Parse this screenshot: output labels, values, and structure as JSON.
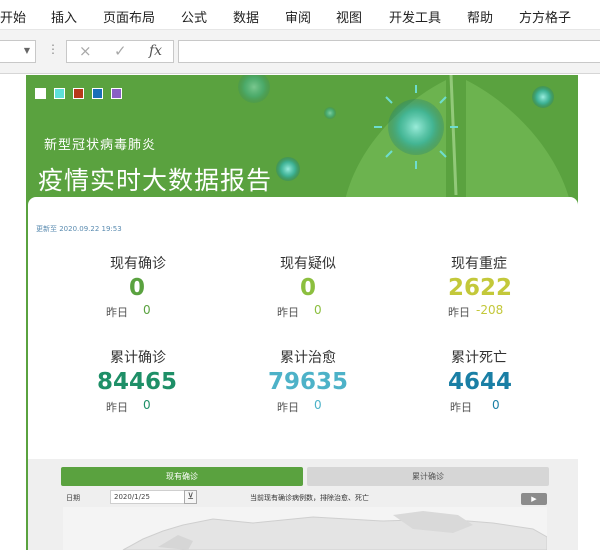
{
  "ribbon": {
    "tabs": [
      "开始",
      "插入",
      "页面布局",
      "公式",
      "数据",
      "审阅",
      "视图",
      "开发工具",
      "帮助",
      "方方格子"
    ]
  },
  "formula_bar": {
    "cancel_icon": "×",
    "enter_icon": "✓",
    "fx_label": "fx"
  },
  "dashboard": {
    "theme_colors": [
      "#ffffff",
      "#5ee0d8",
      "#b83a1a",
      "#1a6fb8",
      "#8a5fc4"
    ],
    "subtitle": "新型冠状病毒肺炎",
    "title": "疫情实时大数据报告",
    "updated": "更新至 2020.09.22 19:53",
    "yesterday_label": "昨日",
    "stats": [
      {
        "label": "现有确诊",
        "value": "0",
        "yesterday": "0",
        "color": "#5aa23f"
      },
      {
        "label": "现有疑似",
        "value": "0",
        "yesterday": "0",
        "color": "#8cbf3f"
      },
      {
        "label": "现有重症",
        "value": "2622",
        "yesterday": "-208",
        "color": "#c3c83a"
      },
      {
        "label": "累计确诊",
        "value": "84465",
        "yesterday": "0",
        "color": "#1e8f67"
      },
      {
        "label": "累计治愈",
        "value": "79635",
        "yesterday": "0",
        "color": "#4db2c8"
      },
      {
        "label": "累计死亡",
        "value": "4644",
        "yesterday": "0",
        "color": "#1a7fa5"
      }
    ],
    "tabs": {
      "active": "现有确诊",
      "inactive": "累计确诊"
    },
    "date_label": "日期",
    "date_value": "2020/1/25",
    "description": "当前现有确诊病例数，排除治愈、死亡"
  }
}
